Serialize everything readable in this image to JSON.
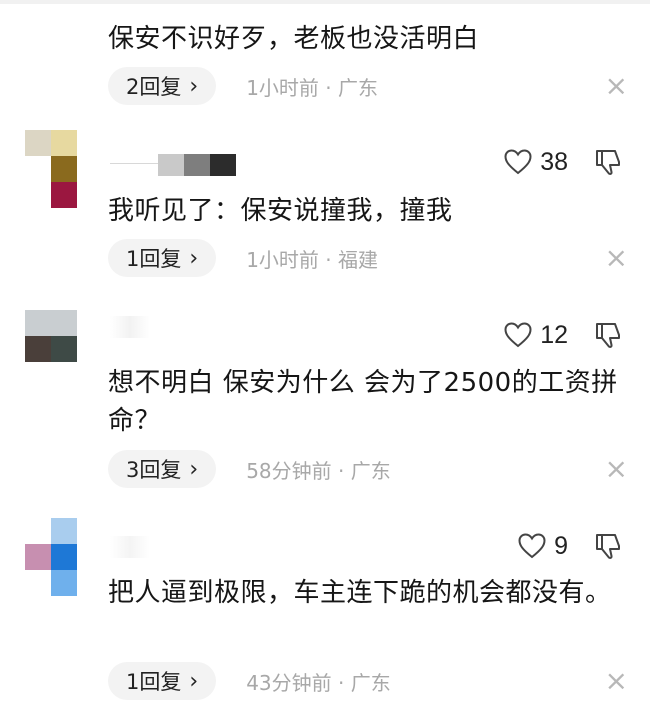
{
  "comments": [
    {
      "text": "保安不识好歹，老板也没活明白",
      "reply_label": "2回复",
      "time": "1小时前 · 广东",
      "close": "×"
    },
    {
      "username": "",
      "likes": "38",
      "text": "我听见了：保安说撞我，撞我",
      "reply_label": "1回复",
      "time": "1小时前 · 福建",
      "close": "×"
    },
    {
      "username": "",
      "likes": "12",
      "text": "想不明白 保安为什么 会为了2500的工资拼命？",
      "reply_label": "3回复",
      "time": "58分钟前 · 广东",
      "close": "×"
    },
    {
      "username": "",
      "likes": "9",
      "text": "把人逼到极限，车主连下跪的机会都没有。",
      "reply_label": "1回复",
      "time": "43分钟前 · 广东",
      "close": "×"
    }
  ],
  "icons": {
    "like": "heart-outline-icon",
    "dislike": "thumbs-down-icon",
    "chevron": "›",
    "close": "close-icon"
  },
  "colors": {
    "text": "#161616",
    "meta": "#a8a8a8",
    "pill_bg": "#f3f3f3"
  }
}
